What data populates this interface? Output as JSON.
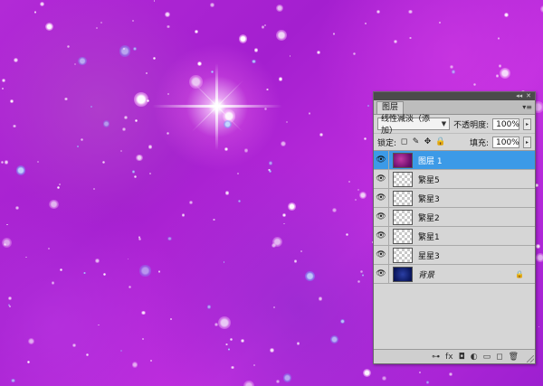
{
  "panel": {
    "topbar": {
      "collapse_glyph": "◂◂",
      "close_glyph": "✕"
    },
    "tab_label": "图层",
    "menu_glyph": "▾≡",
    "blend": {
      "mode": "线性减淡（添加）",
      "opacity_label": "不透明度:",
      "opacity_value": "100%"
    },
    "lock": {
      "label": "锁定:",
      "fill_label": "填充:",
      "fill_value": "100%"
    }
  },
  "layers": [
    {
      "name": "图层 1",
      "selected": true,
      "thumb": "purple",
      "italic": false,
      "locked": false
    },
    {
      "name": "繁星5",
      "selected": false,
      "thumb": "transparent",
      "italic": false,
      "locked": false
    },
    {
      "name": "繁星3",
      "selected": false,
      "thumb": "transparent",
      "italic": false,
      "locked": false
    },
    {
      "name": "繁星2",
      "selected": false,
      "thumb": "transparent",
      "italic": false,
      "locked": false
    },
    {
      "name": "繁星1",
      "selected": false,
      "thumb": "transparent",
      "italic": false,
      "locked": false
    },
    {
      "name": "星星3",
      "selected": false,
      "thumb": "transparent",
      "italic": false,
      "locked": false
    },
    {
      "name": "背景",
      "selected": false,
      "thumb": "navy",
      "italic": true,
      "locked": true
    }
  ],
  "bottom_icons": {
    "link": "⊶",
    "fx": "fx",
    "mask": "◘",
    "adjust": "◐",
    "group": "▭",
    "new_layer": "◻",
    "delete": "🗑"
  },
  "colors": {
    "selection": "#3c9ae7",
    "canvas_purple": "#b22ad6"
  }
}
